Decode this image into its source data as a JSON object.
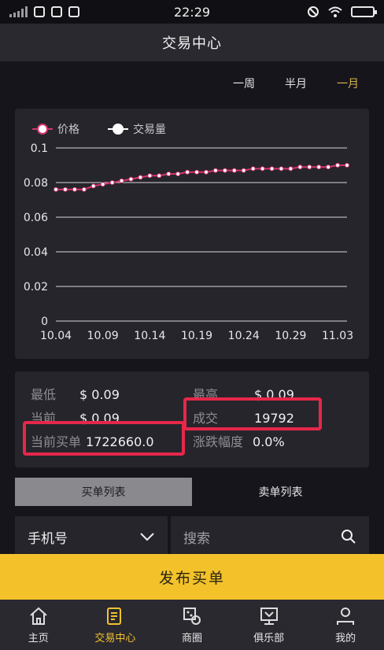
{
  "status_bar": {
    "time": "22:29"
  },
  "header": {
    "title": "交易中心"
  },
  "periods": [
    {
      "label": "一周",
      "active": false
    },
    {
      "label": "半月",
      "active": false
    },
    {
      "label": "一月",
      "active": true
    }
  ],
  "chart_data": {
    "type": "line",
    "legend": [
      "价格",
      "交易量"
    ],
    "legend_placement": "top-left",
    "ylim": [
      0,
      0.1
    ],
    "y_ticks": [
      "0",
      "0.02",
      "0.04",
      "0.06",
      "0.08",
      "0.1"
    ],
    "x_ticks": [
      "10.04",
      "10.09",
      "10.14",
      "10.19",
      "10.24",
      "10.29",
      "11.03"
    ],
    "x": [
      "10.04",
      "10.05",
      "10.06",
      "10.07",
      "10.08",
      "10.09",
      "10.10",
      "10.11",
      "10.12",
      "10.13",
      "10.14",
      "10.15",
      "10.16",
      "10.17",
      "10.18",
      "10.19",
      "10.20",
      "10.21",
      "10.22",
      "10.23",
      "10.24",
      "10.25",
      "10.26",
      "10.27",
      "10.28",
      "10.29",
      "10.30",
      "10.31",
      "11.01",
      "11.02",
      "11.03",
      "11.04"
    ],
    "series": [
      {
        "name": "价格",
        "color": "#d6336c",
        "values": [
          0.076,
          0.076,
          0.076,
          0.076,
          0.078,
          0.079,
          0.08,
          0.081,
          0.082,
          0.083,
          0.084,
          0.084,
          0.085,
          0.085,
          0.086,
          0.086,
          0.086,
          0.087,
          0.087,
          0.087,
          0.087,
          0.088,
          0.088,
          0.088,
          0.088,
          0.088,
          0.089,
          0.089,
          0.089,
          0.089,
          0.09,
          0.09
        ]
      },
      {
        "name": "交易量",
        "color": "#ffffff",
        "values": []
      }
    ],
    "grid": true
  },
  "stats": {
    "low_label": "最低",
    "low_value": "$ 0.09",
    "high_label": "最高",
    "high_value": "$ 0.09",
    "current_label": "当前",
    "current_value": "$ 0.09",
    "deal_label": "成交",
    "deal_value": "19792",
    "buy_label": "当前买单",
    "buy_value": "1722660.0",
    "change_label": "涨跌幅度",
    "change_value": "0.0%"
  },
  "list_tabs": [
    {
      "label": "买单列表",
      "active": true
    },
    {
      "label": "卖单列表",
      "active": false
    }
  ],
  "filter": {
    "select_value": "手机号",
    "search_placeholder": "搜索"
  },
  "publish_button": "发布买单",
  "bottom_nav": [
    {
      "label": "主页",
      "icon": "home-icon",
      "active": false
    },
    {
      "label": "交易中心",
      "icon": "trade-icon",
      "active": true
    },
    {
      "label": "商圈",
      "icon": "market-icon",
      "active": false
    },
    {
      "label": "俱乐部",
      "icon": "club-icon",
      "active": false
    },
    {
      "label": "我的",
      "icon": "user-icon",
      "active": false
    }
  ],
  "colors": {
    "accent": "#f3c22b",
    "highlight": "#e6274a",
    "price_line": "#d6336c"
  }
}
